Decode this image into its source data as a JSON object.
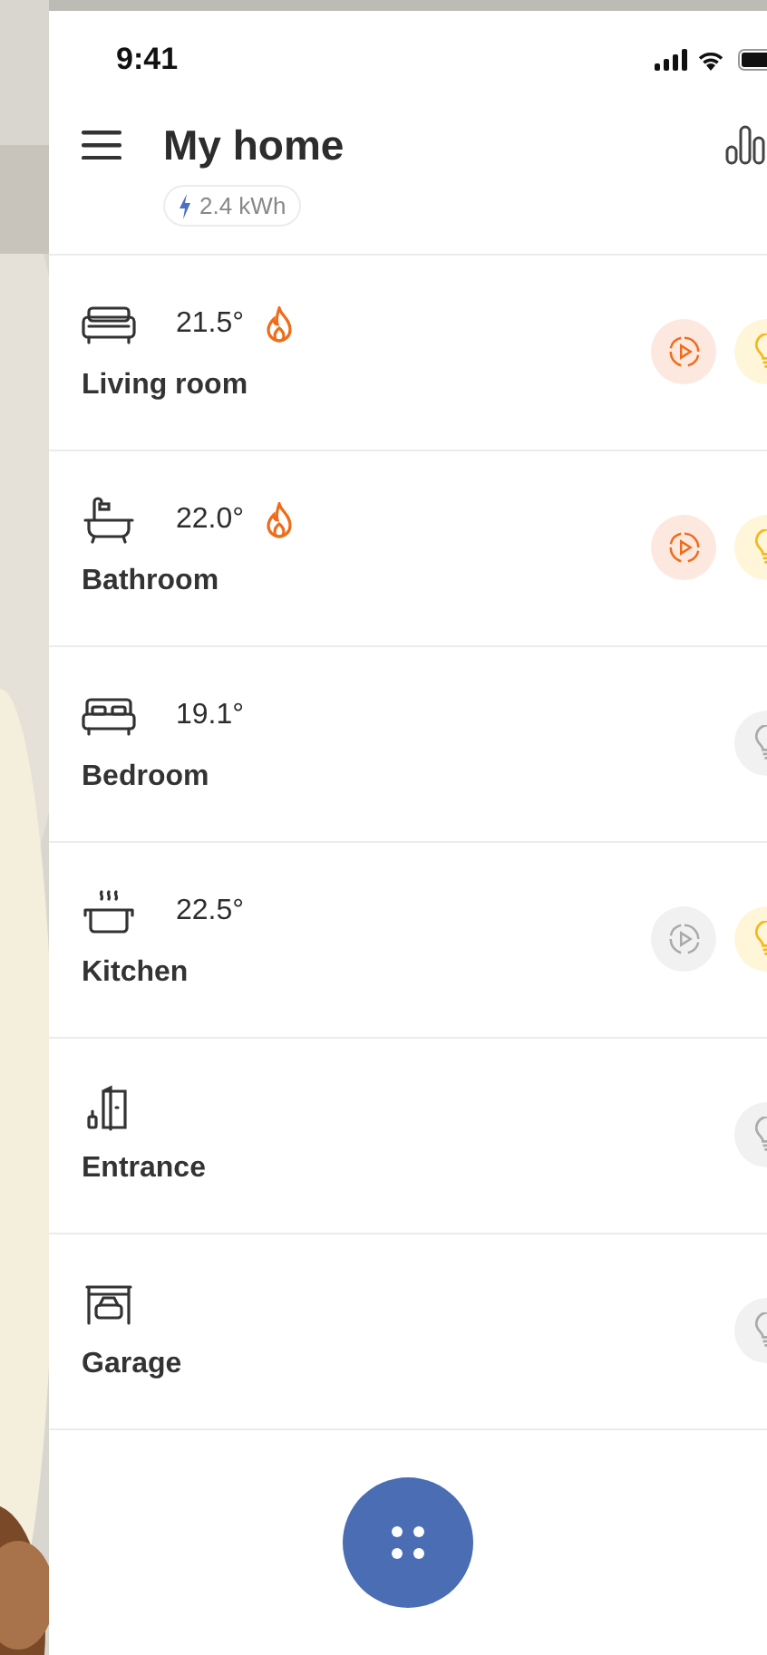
{
  "status_bar": {
    "time": "9:41"
  },
  "header": {
    "title": "My home",
    "energy": "2.4 kWh"
  },
  "rooms": [
    {
      "name": "Living room",
      "kind": "sofa",
      "temperature": "21.5°",
      "heating": true,
      "media": {
        "on": true
      },
      "light_on": true
    },
    {
      "name": "Bathroom",
      "kind": "bath",
      "temperature": "22.0°",
      "heating": true,
      "media": {
        "on": true
      },
      "light_on": true
    },
    {
      "name": "Bedroom",
      "kind": "bed",
      "temperature": "19.1°",
      "heating": false,
      "light_on": false
    },
    {
      "name": "Kitchen",
      "kind": "pot",
      "temperature": "22.5°",
      "heating": false,
      "media": {
        "on": false
      },
      "light_on": true
    },
    {
      "name": "Entrance",
      "kind": "door",
      "heating": false,
      "light_on": false
    },
    {
      "name": "Garage",
      "kind": "garage",
      "heating": false,
      "light_on": false
    }
  ]
}
